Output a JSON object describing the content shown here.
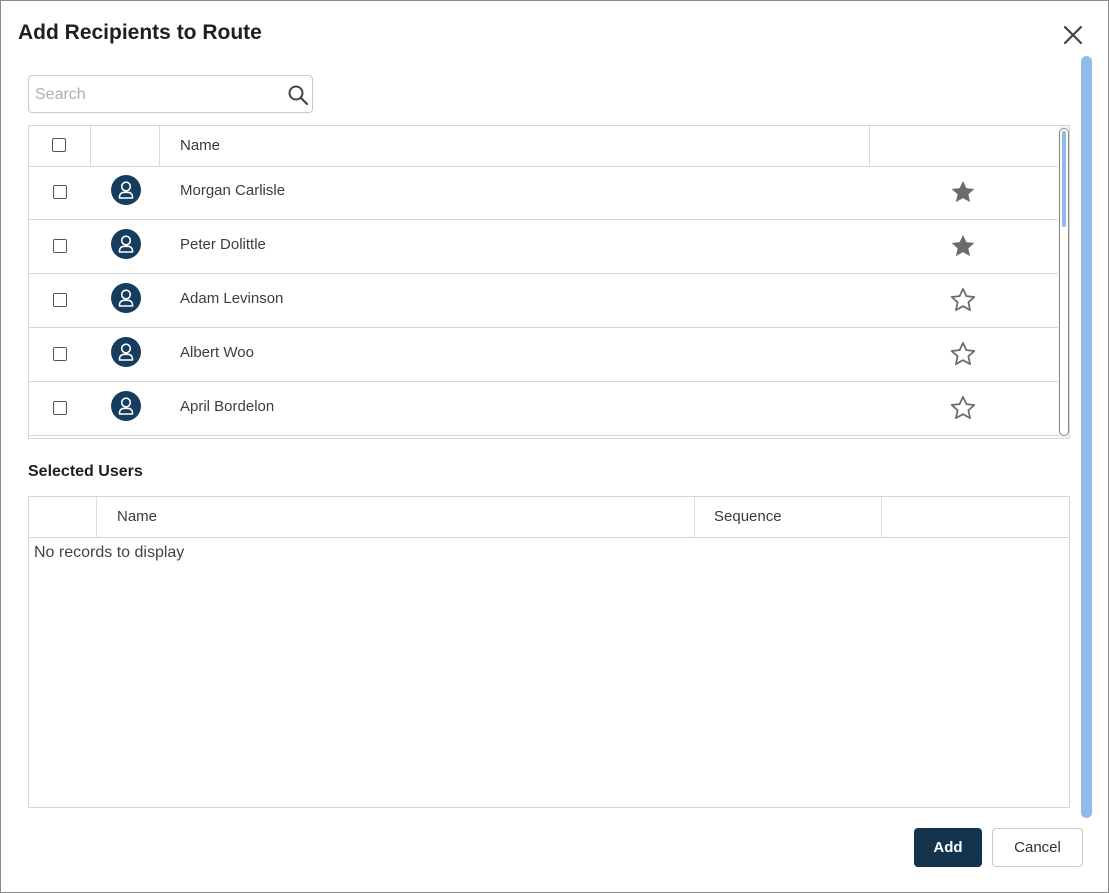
{
  "dialog": {
    "title": "Add Recipients to Route"
  },
  "search": {
    "placeholder": "Search",
    "value": ""
  },
  "recipients_grid": {
    "columns": [
      "",
      "",
      "Name",
      ""
    ],
    "rows": [
      {
        "name": "Morgan Carlisle",
        "favorite": true
      },
      {
        "name": "Peter Dolittle",
        "favorite": true
      },
      {
        "name": "Adam Levinson",
        "favorite": false
      },
      {
        "name": "Albert Woo",
        "favorite": false
      },
      {
        "name": "April Bordelon",
        "favorite": false
      }
    ]
  },
  "selected_users": {
    "title": "Selected Users",
    "columns": [
      "",
      "Name",
      "Sequence",
      ""
    ],
    "empty_message": "No records to display"
  },
  "buttons": {
    "add": "Add",
    "cancel": "Cancel"
  },
  "colors": {
    "primary": "#14334d",
    "avatar": "#173d5e",
    "star": "#6b6b6b",
    "scrollbar": "#8ebbea"
  },
  "icons": {
    "close": "close-icon",
    "search": "search-icon",
    "avatar": "user-avatar-icon",
    "star_filled": "star-filled-icon",
    "star_outline": "star-outline-icon"
  }
}
